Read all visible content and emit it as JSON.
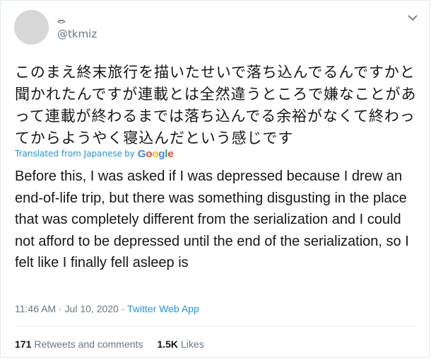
{
  "user": {
    "display_name": "ᕙᕗ",
    "handle": "@tkmiz"
  },
  "tweet": {
    "original_text": "このまえ終末旅行を描いたせいで落ち込んでるんですかと聞かれたんですが連載とは全然違うところで嫌なことがあって連載が終わるまでは落ち込んでる余裕がなくて終わってからようやく寝込んだという感じです",
    "translated_label": "Translated from Japanese",
    "by_label": "by",
    "google_logo": [
      "G",
      "o",
      "o",
      "g",
      "l",
      "e"
    ],
    "translated_text": "Before this, I was asked if I was depressed because I drew an end-of-life trip, but there was something disgusting in the place that was completely different from the serialization and I could not afford to be depressed until the end of the serialization, so I felt like I finally fell asleep is",
    "time": "11:46 AM · Jul 10, 2020",
    "separator": " · ",
    "source": "Twitter Web App"
  },
  "stats": {
    "retweets_count": "171",
    "retweets_label": "Retweets and comments",
    "likes_count": "1.5K",
    "likes_label": "Likes"
  },
  "colors": {
    "link": "#1b95e0",
    "muted": "#657786",
    "text": "#14171a",
    "border": "#e1e8ed"
  },
  "icons": {
    "menu": "chevron-down-icon"
  }
}
